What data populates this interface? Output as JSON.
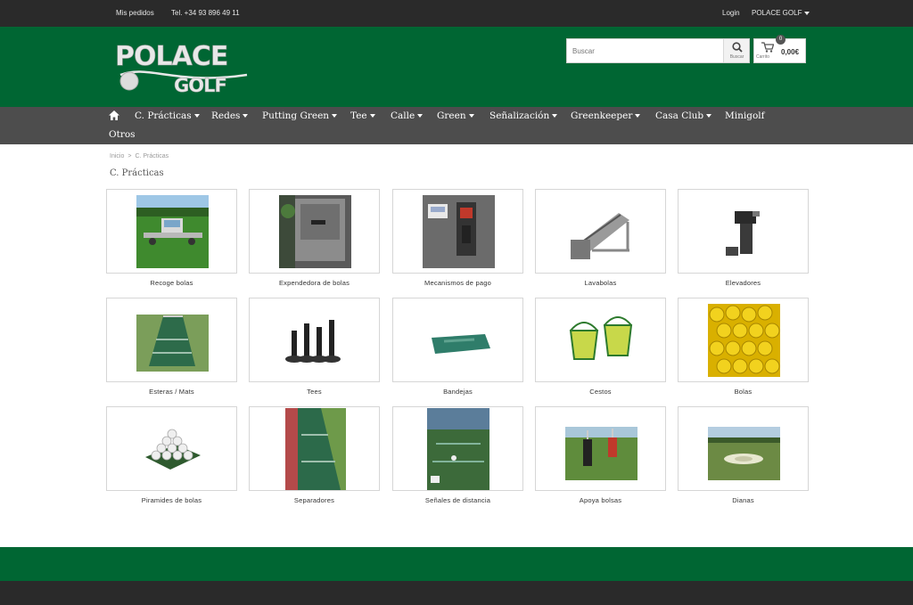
{
  "topbar": {
    "orders": "Mis pedidos",
    "phone": "Tel. +34 93 896 49 11",
    "login": "Login",
    "account": "POLACE GOLF"
  },
  "brand": {
    "line1": "POLACE",
    "line2": "GOLF"
  },
  "search": {
    "placeholder": "Buscar",
    "button_label": "Buscar"
  },
  "cart": {
    "label": "Carrito",
    "count": "0",
    "total": "0,00€"
  },
  "nav": [
    {
      "label": "C. Prácticas",
      "dropdown": true
    },
    {
      "label": "Redes",
      "dropdown": true
    },
    {
      "label": "Putting Green",
      "dropdown": true
    },
    {
      "label": "Tee",
      "dropdown": true
    },
    {
      "label": "Calle",
      "dropdown": true
    },
    {
      "label": "Green",
      "dropdown": true
    },
    {
      "label": "Señalización",
      "dropdown": true
    },
    {
      "label": "Greenkeeper",
      "dropdown": true
    },
    {
      "label": "Casa Club",
      "dropdown": true
    },
    {
      "label": "Minigolf",
      "dropdown": false
    },
    {
      "label": "Otros",
      "dropdown": false
    }
  ],
  "breadcrumb": {
    "home": "Inicio",
    "sep": ">",
    "current": "C. Prácticas"
  },
  "page_title": "C. Prácticas",
  "products": [
    {
      "name": "Recoge bolas",
      "icon": "range-picker-icon"
    },
    {
      "name": "Expendedora de bolas",
      "icon": "ball-dispenser-icon"
    },
    {
      "name": "Mecanismos de pago",
      "icon": "payment-mechanism-icon"
    },
    {
      "name": "Lavabolas",
      "icon": "ball-washer-icon"
    },
    {
      "name": "Elevadores",
      "icon": "elevator-icon"
    },
    {
      "name": "Esteras / Mats",
      "icon": "mat-icon"
    },
    {
      "name": "Tees",
      "icon": "tee-icon"
    },
    {
      "name": "Bandejas",
      "icon": "tray-icon"
    },
    {
      "name": "Cestos",
      "icon": "basket-icon"
    },
    {
      "name": "Bolas",
      "icon": "balls-icon"
    },
    {
      "name": "Piramides de bolas",
      "icon": "ball-pyramid-icon"
    },
    {
      "name": "Separadores",
      "icon": "divider-icon"
    },
    {
      "name": "Señales de distancia",
      "icon": "distance-sign-icon"
    },
    {
      "name": "Apoya bolsas",
      "icon": "bag-stand-icon"
    },
    {
      "name": "Dianas",
      "icon": "target-icon"
    }
  ],
  "colors": {
    "brand_green": "#006633",
    "dark": "#2a2a2a",
    "nav": "#4d4d4d"
  }
}
